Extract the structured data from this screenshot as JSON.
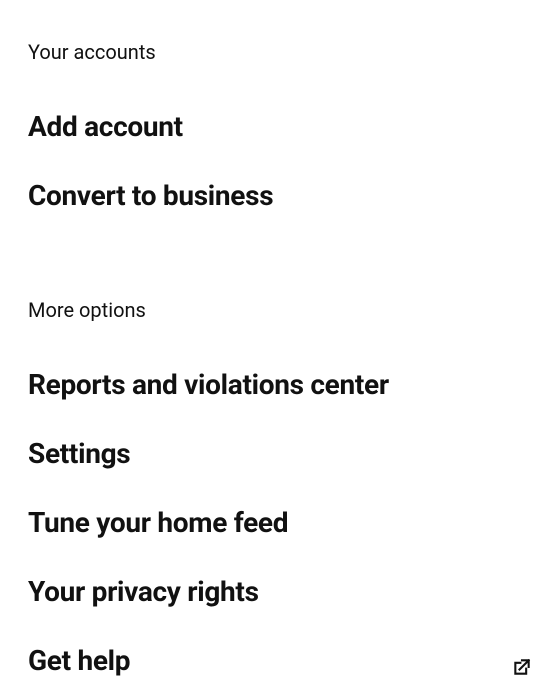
{
  "sections": {
    "accounts": {
      "header": "Your accounts",
      "items": {
        "add_account": "Add account",
        "convert_business": "Convert to business"
      }
    },
    "more_options": {
      "header": "More options",
      "items": {
        "reports": "Reports and violations center",
        "settings": "Settings",
        "tune_feed": "Tune your home feed",
        "privacy": "Your privacy rights",
        "get_help": "Get help"
      }
    }
  }
}
